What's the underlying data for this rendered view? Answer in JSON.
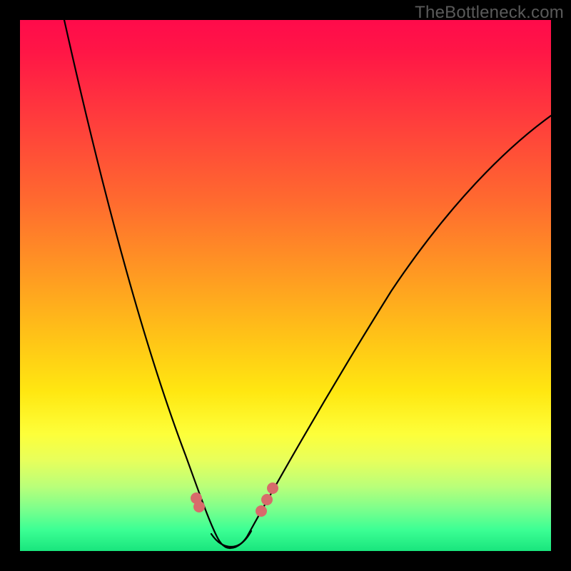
{
  "watermark": "TheBottleneck.com",
  "chart_data": {
    "type": "line",
    "title": "",
    "xlabel": "",
    "ylabel": "",
    "xlim": [
      0,
      100
    ],
    "ylim": [
      0,
      100
    ],
    "grid": false,
    "legend": false,
    "series": [
      {
        "name": "bottleneck-curve",
        "x": [
          0,
          5,
          10,
          15,
          20,
          25,
          30,
          34,
          36,
          38,
          40,
          44,
          50,
          60,
          70,
          80,
          90,
          100
        ],
        "y": [
          100,
          85,
          70,
          56,
          42,
          30,
          18,
          8,
          4,
          2,
          4,
          10,
          22,
          38,
          52,
          63,
          73,
          82
        ]
      }
    ],
    "highlight_region": {
      "name": "near-minimum-markers",
      "x_range": [
        30,
        44
      ],
      "y_range": [
        1,
        18
      ]
    },
    "gradient_stops": [
      {
        "pos": 0.0,
        "color": "#ff0b4b"
      },
      {
        "pos": 0.18,
        "color": "#ff3a3d"
      },
      {
        "pos": 0.48,
        "color": "#ff9a22"
      },
      {
        "pos": 0.78,
        "color": "#fdff3a"
      },
      {
        "pos": 1.0,
        "color": "#19e57d"
      }
    ]
  }
}
